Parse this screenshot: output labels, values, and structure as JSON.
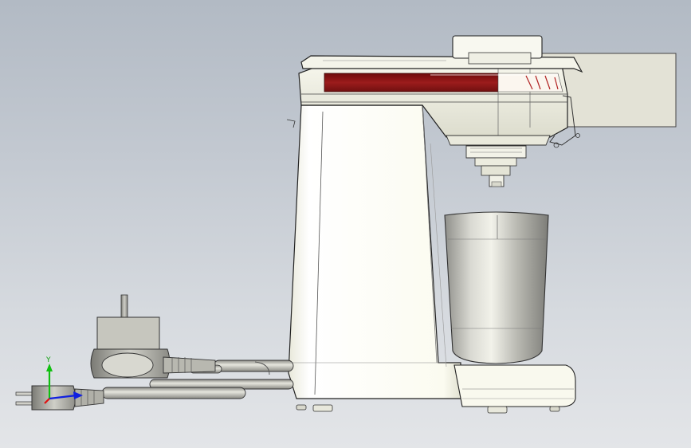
{
  "viewport": {
    "background_top": "#b2bac4",
    "background_bottom": "#e3e5e8"
  },
  "model": {
    "parts": [
      "coffee-maker-body",
      "top-lid",
      "red-accent-band",
      "brew-head",
      "drip-nozzle",
      "carafe-cup",
      "drip-tray-base",
      "rear-panel",
      "power-cord",
      "eu-plug",
      "us-plug"
    ],
    "accent_color": "#8a1616",
    "body_color": "#fbfbef",
    "cup_color": "#a9a9a3"
  },
  "triad": {
    "y_label": "Y",
    "x_color": "#e01010",
    "y_color": "#10c010",
    "z_color": "#1020e0"
  }
}
